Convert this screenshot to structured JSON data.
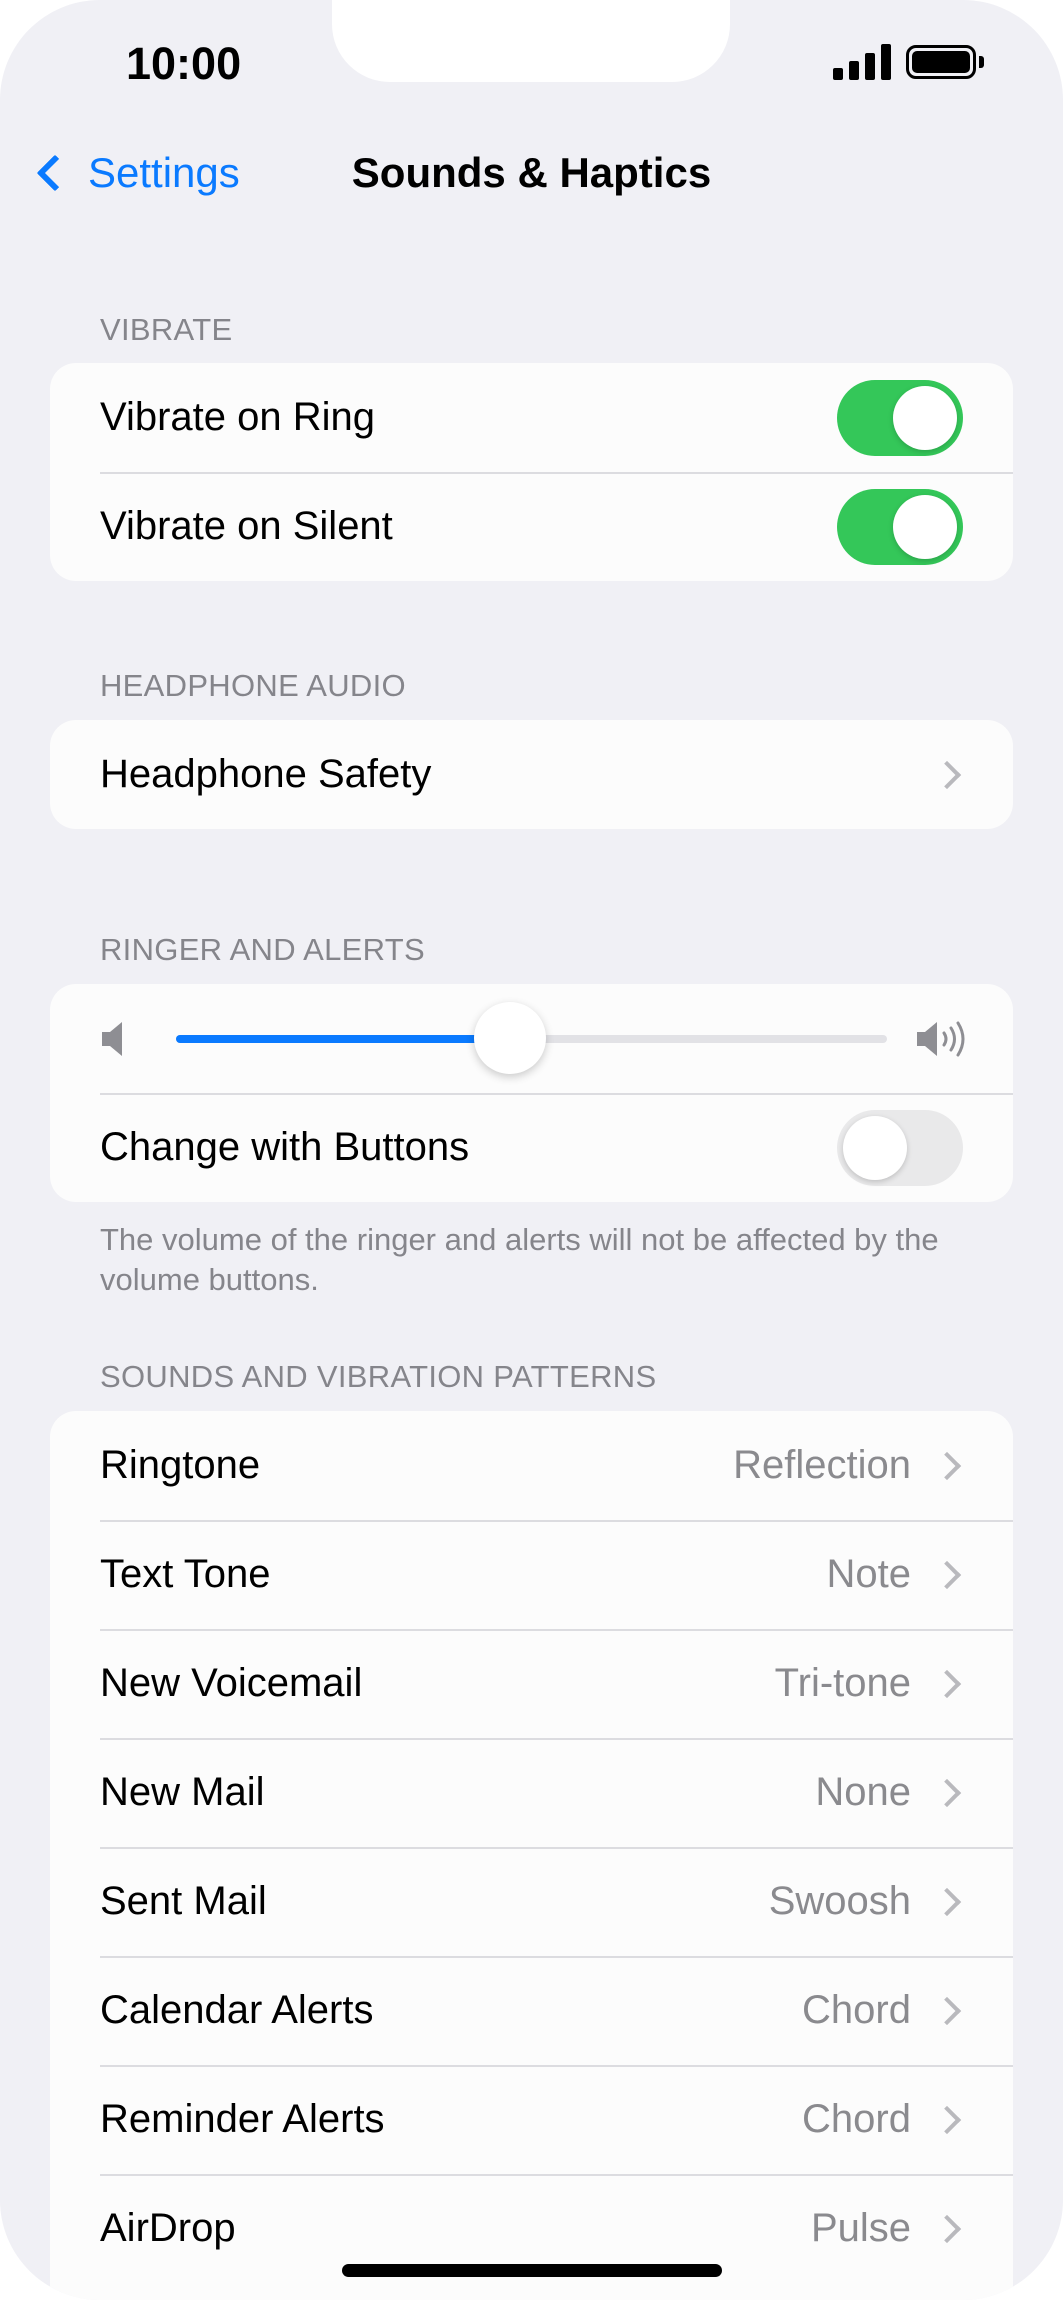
{
  "status_bar": {
    "time": "10:00",
    "signal_bars": 4,
    "battery_level": 1.0
  },
  "nav": {
    "back_label": "Settings",
    "title": "Sounds & Haptics"
  },
  "vibrate": {
    "header": "VIBRATE",
    "items": [
      {
        "label": "Vibrate on Ring",
        "on": true
      },
      {
        "label": "Vibrate on Silent",
        "on": true
      }
    ]
  },
  "headphone": {
    "header": "HEADPHONE AUDIO",
    "items": [
      {
        "label": "Headphone Safety"
      }
    ]
  },
  "ringer": {
    "header": "RINGER AND ALERTS",
    "volume": 0.47,
    "change_with_buttons": {
      "label": "Change with Buttons",
      "on": false
    },
    "footnote": "The volume of the ringer and alerts will not be affected by the volume buttons."
  },
  "sounds": {
    "header": "SOUNDS AND VIBRATION PATTERNS",
    "items": [
      {
        "label": "Ringtone",
        "value": "Reflection"
      },
      {
        "label": "Text Tone",
        "value": "Note"
      },
      {
        "label": "New Voicemail",
        "value": "Tri-tone"
      },
      {
        "label": "New Mail",
        "value": "None"
      },
      {
        "label": "Sent Mail",
        "value": "Swoosh"
      },
      {
        "label": "Calendar Alerts",
        "value": "Chord"
      },
      {
        "label": "Reminder Alerts",
        "value": "Chord"
      },
      {
        "label": "AirDrop",
        "value": "Pulse"
      }
    ]
  },
  "colors": {
    "accent": "#0a7aff",
    "toggle_on": "#34c759",
    "background": "#f0f0f5"
  }
}
